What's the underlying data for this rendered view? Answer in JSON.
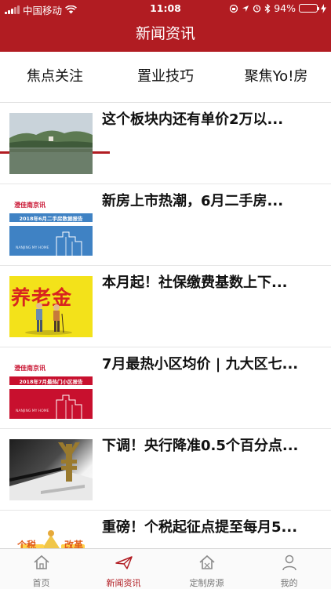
{
  "status_bar": {
    "carrier": "中国移动",
    "time": "11:08",
    "battery": "94%"
  },
  "header": {
    "title": "新闻资讯"
  },
  "tabs": [
    {
      "label": "焦点关注",
      "active": true
    },
    {
      "label": "置业技巧",
      "active": false
    },
    {
      "label": "聚焦Yo!房",
      "active": false
    }
  ],
  "articles": [
    {
      "title": "这个板块内还有单价2万以...",
      "thumb": "lake-landscape"
    },
    {
      "title": "新房上市热潮，6月二手房...",
      "thumb": "report-banner",
      "thumb_brand": "澄佳南京讯",
      "thumb_caption": "2018年6月二手房数据报告",
      "thumb_tag": "NANJING MY HOME"
    },
    {
      "title": "本月起！社保缴费基数上下...",
      "thumb": "pension-poster",
      "thumb_text": "养老金"
    },
    {
      "title": "7月最热小区均价 | 九大区七...",
      "thumb": "report-banner",
      "thumb_brand": "澄佳南京讯",
      "thumb_caption": "2018年7月最热门小区报告",
      "thumb_tag": "NANJING MY HOME"
    },
    {
      "title": "下调！央行降准0.5个百分点...",
      "thumb": "yuan-sculpture"
    },
    {
      "title": "重磅！个税起征点提至每月5...",
      "thumb": "tax-cartoon",
      "thumb_text_left": "个税",
      "thumb_text_right": "改革"
    }
  ],
  "tabbar": [
    {
      "label": "首页",
      "icon": "home-icon",
      "active": false
    },
    {
      "label": "新闻资讯",
      "icon": "paper-plane-icon",
      "active": true
    },
    {
      "label": "定制房源",
      "icon": "house-custom-icon",
      "active": false
    },
    {
      "label": "我的",
      "icon": "person-icon",
      "active": false
    }
  ],
  "colors": {
    "brand_red": "#b11c22",
    "report_blue": "#3f82c4",
    "battery_green": "#5ecf49"
  }
}
